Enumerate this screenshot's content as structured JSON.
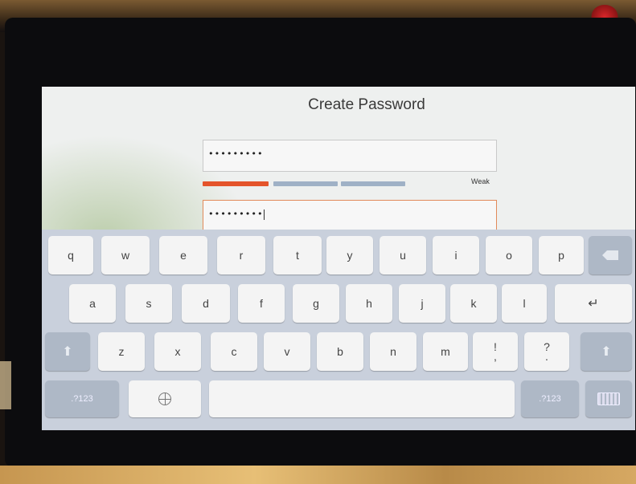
{
  "screen": {
    "title": "Create Password",
    "password_field": {
      "value": "•••••••••"
    },
    "confirm_field": {
      "value": "•••••••••"
    },
    "strength": {
      "label": "Weak",
      "level": 1,
      "max_level": 3
    }
  },
  "keyboard": {
    "row1": [
      "q",
      "w",
      "e",
      "r",
      "t",
      "y",
      "u",
      "i",
      "o",
      "p"
    ],
    "row2": [
      "a",
      "s",
      "d",
      "f",
      "g",
      "h",
      "j",
      "k",
      "l"
    ],
    "row3": [
      "z",
      "x",
      "c",
      "v",
      "b",
      "n",
      "m",
      "!",
      "?"
    ],
    "row3_sub": [
      ",",
      "."
    ],
    "numbers_label": ".?123",
    "icons": {
      "backspace": "backspace-icon",
      "enter": "return-icon",
      "shift": "shift-icon",
      "globe": "globe-icon",
      "hide": "keyboard-icon"
    },
    "colors": {
      "background": "#c9d0dc",
      "key": "#f4f4f4",
      "function_key": "#aeb8c6"
    }
  },
  "colors": {
    "strength_active": "#e4542b",
    "strength_inactive": "#9fb1c6"
  }
}
